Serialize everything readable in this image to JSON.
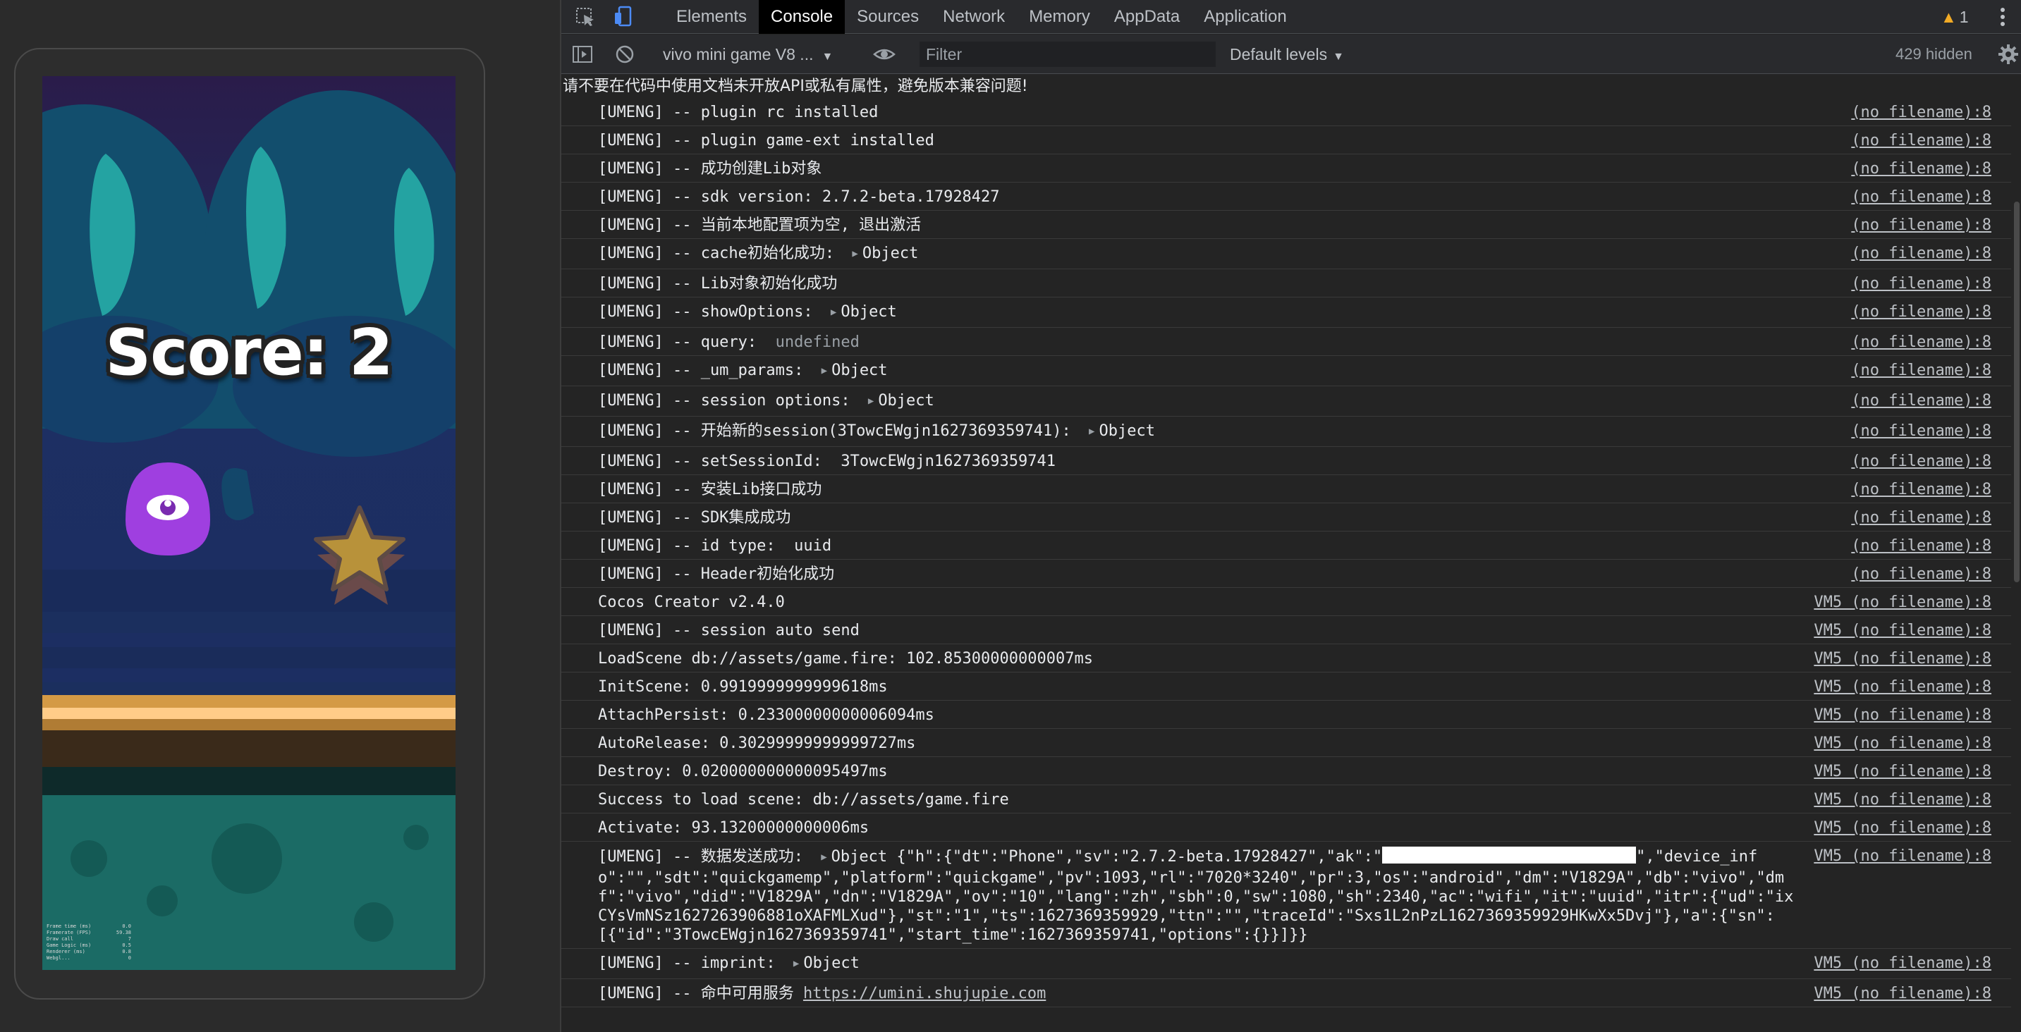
{
  "game": {
    "score_label": "Score: 2",
    "stats": [
      {
        "label": "Frame time (ms)",
        "value": "0.0"
      },
      {
        "label": "Framerate (FPS)",
        "value": "59.38"
      },
      {
        "label": "Draw call",
        "value": "7"
      },
      {
        "label": "Game Logic (ms)",
        "value": "0.5"
      },
      {
        "label": "Renderer (ms)",
        "value": "0.8"
      },
      {
        "label": "Webgl...",
        "value": "0"
      }
    ]
  },
  "devtools": {
    "tabs": [
      "Elements",
      "Console",
      "Sources",
      "Network",
      "Memory",
      "AppData",
      "Application"
    ],
    "active_tab": "Console",
    "warning_count": "1",
    "context": "vivo mini game V8 ...",
    "filter_placeholder": "Filter",
    "levels": "Default levels",
    "hidden_count": "429 hidden"
  },
  "console": {
    "banner": "请不要在代码中使用文档未开放API或私有属性，避免版本兼容问题!",
    "rows": [
      {
        "msg": "[UMENG] -- plugin rc installed",
        "src": "(no filename):8"
      },
      {
        "msg": "[UMENG] -- plugin game-ext installed",
        "src": "(no filename):8"
      },
      {
        "msg": "[UMENG] -- 成功创建Lib对象",
        "src": "(no filename):8"
      },
      {
        "msg": "[UMENG] -- sdk version: 2.7.2-beta.17928427",
        "src": "(no filename):8"
      },
      {
        "msg": "[UMENG] -- 当前本地配置项为空, 退出激活",
        "src": "(no filename):8"
      },
      {
        "msg": "[UMENG] -- cache初始化成功: ",
        "obj": "Object",
        "src": "(no filename):8"
      },
      {
        "msg": "[UMENG] -- Lib对象初始化成功",
        "src": "(no filename):8"
      },
      {
        "msg": "[UMENG] -- showOptions: ",
        "obj": "Object",
        "src": "(no filename):8"
      },
      {
        "msg": "[UMENG] -- query:  ",
        "dim": "undefined",
        "src": "(no filename):8"
      },
      {
        "msg": "[UMENG] -- _um_params: ",
        "obj": "Object",
        "src": "(no filename):8"
      },
      {
        "msg": "[UMENG] -- session options: ",
        "obj": "Object",
        "src": "(no filename):8"
      },
      {
        "msg": "[UMENG] -- 开始新的session(3TowcEWgjn1627369359741): ",
        "obj": "Object",
        "src": "(no filename):8"
      },
      {
        "msg": "[UMENG] -- setSessionId:  3TowcEWgjn1627369359741",
        "src": "(no filename):8"
      },
      {
        "msg": "[UMENG] -- 安装Lib接口成功",
        "src": "(no filename):8"
      },
      {
        "msg": "[UMENG] -- SDK集成成功",
        "src": "(no filename):8"
      },
      {
        "msg": "[UMENG] -- id type:  uuid",
        "src": "(no filename):8"
      },
      {
        "msg": "[UMENG] -- Header初始化成功",
        "src": "(no filename):8"
      },
      {
        "msg": "Cocos Creator v2.4.0",
        "src": "VM5 (no filename):8"
      },
      {
        "msg": "[UMENG] -- session auto send",
        "src": "VM5 (no filename):8"
      },
      {
        "msg": "LoadScene db://assets/game.fire: 102.85300000000007ms",
        "src": "VM5 (no filename):8"
      },
      {
        "msg": "InitScene: 0.9919999999999618ms",
        "src": "VM5 (no filename):8"
      },
      {
        "msg": "AttachPersist: 0.23300000000006094ms",
        "src": "VM5 (no filename):8"
      },
      {
        "msg": "AutoRelease: 0.30299999999999727ms",
        "src": "VM5 (no filename):8"
      },
      {
        "msg": "Destroy: 0.020000000000095497ms",
        "src": "VM5 (no filename):8"
      },
      {
        "msg": "Success to load scene: db://assets/game.fire",
        "src": "VM5 (no filename):8"
      },
      {
        "msg": "Activate: 93.13200000000006ms",
        "src": "VM5 (no filename):8"
      },
      {
        "msg": "[UMENG] -- 数据发送成功: ",
        "obj": "Object",
        "tail_pre": " {\"h\":{\"dt\":\"Phone\",\"sv\":\"2.7.2-beta.17928427\",\"ak\":\"",
        "redacted": true,
        "tail": "\",\"device_info\":\"\",\"sdt\":\"quickgamemp\",\"platform\":\"quickgame\",\"pv\":1093,\"rl\":\"7020*3240\",\"pr\":3,\"os\":\"android\",\"dm\":\"V1829A\",\"db\":\"vivo\",\"dmf\":\"vivo\",\"did\":\"V1829A\",\"dn\":\"V1829A\",\"ov\":\"10\",\"lang\":\"zh\",\"sbh\":0,\"sw\":1080,\"sh\":2340,\"ac\":\"wifi\",\"it\":\"uuid\",\"itr\":{\"ud\":\"ixCYsVmNSz1627263906881oXAFMLXud\"},\"st\":\"1\",\"ts\":1627369359929,\"ttn\":\"\",\"traceId\":\"Sxs1L2nPzL1627369359929HKwXx5Dvj\"},\"a\":{\"sn\":[{\"id\":\"3TowcEWgjn1627369359741\",\"start_time\":1627369359741,\"options\":{}}]}}",
        "src": "VM5 (no filename):8"
      },
      {
        "msg": "[UMENG] -- imprint: ",
        "obj": "Object",
        "src": "VM5 (no filename):8"
      },
      {
        "msg": "[UMENG] -- 命中可用服务 ",
        "link": "https://umini.shujupie.com",
        "src": "VM5 (no filename):8"
      }
    ]
  },
  "colors": {
    "accent": "#ffffff",
    "warning": "#f2ab26",
    "panel_bg": "#242424",
    "toolbar_bg": "#292a2d",
    "player_purple": "#9f3fe0",
    "star_gold": "#b8923a"
  },
  "icons": [
    "inspect-icon",
    "device-toolbar-icon",
    "warning-icon",
    "kebab-menu-icon",
    "sidebar-toggle-icon",
    "clear-console-icon",
    "eye-icon",
    "settings-gear-icon"
  ]
}
